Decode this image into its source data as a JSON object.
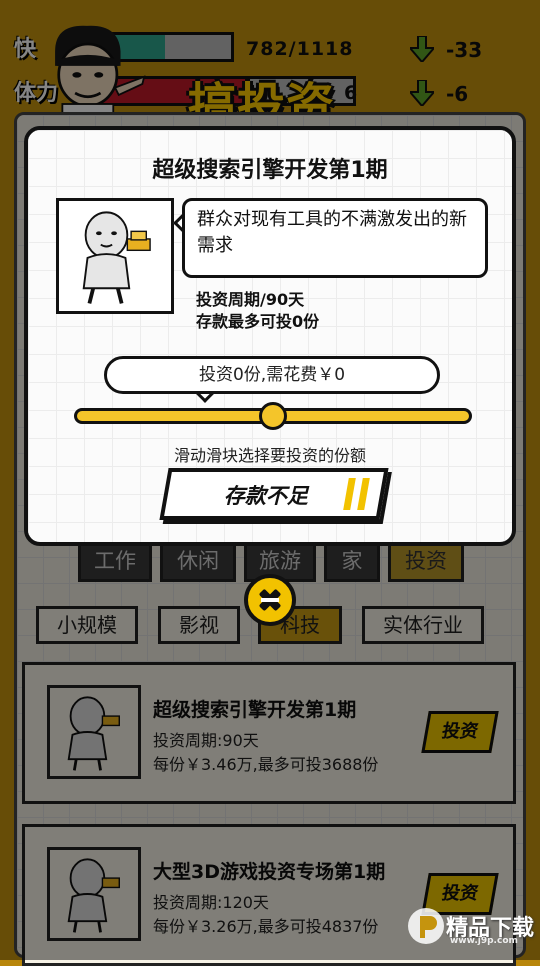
{
  "stats": {
    "happiness": {
      "label": "快",
      "value": "782/1118",
      "delta": "-33",
      "fill_fraction": 0.5,
      "color": "#2fa88f"
    },
    "health": {
      "label": "体力",
      "value": "6",
      "delta": "-6",
      "fill_fraction": 0.58,
      "color": "#c21a2a"
    }
  },
  "logo": {
    "text": "搞投资"
  },
  "tabs": [
    {
      "label": "工作",
      "active": false
    },
    {
      "label": "休闲",
      "active": false
    },
    {
      "label": "旅游",
      "active": false
    },
    {
      "label": "家",
      "active": false
    },
    {
      "label": "投资",
      "active": true
    }
  ],
  "subtabs": [
    {
      "label": "小规模",
      "active": false
    },
    {
      "label": "影视",
      "active": false
    },
    {
      "label": "科技",
      "active": true
    },
    {
      "label": "实体行业",
      "active": false
    }
  ],
  "list": [
    {
      "title": "超级搜索引擎开发第1期",
      "period": "投资周期:90天",
      "price": "每份￥3.46万,最多可投3688份",
      "button": "投资"
    },
    {
      "title": "大型3D游戏投资专场第1期",
      "period": "投资周期:120天",
      "price": "每份￥3.26万,最多可投4837份",
      "button": "投资"
    }
  ],
  "modal": {
    "title": "超级搜索引擎开发第1期",
    "description": "群众对现有工具的不满激发出的新需求",
    "period": "投资周期/90天",
    "max_from_savings": "存款最多可投0份",
    "selection": "投资0份,需花费￥0",
    "slider_fraction": 0.5,
    "hint": "滑动滑块选择要投资的份额",
    "confirm_label": "存款不足"
  },
  "watermark": {
    "text": "精品下载",
    "url": "www.j9p.com"
  },
  "colors": {
    "accent": "#f2c200",
    "background": "#c5940e",
    "panel": "#f6f2e6"
  }
}
